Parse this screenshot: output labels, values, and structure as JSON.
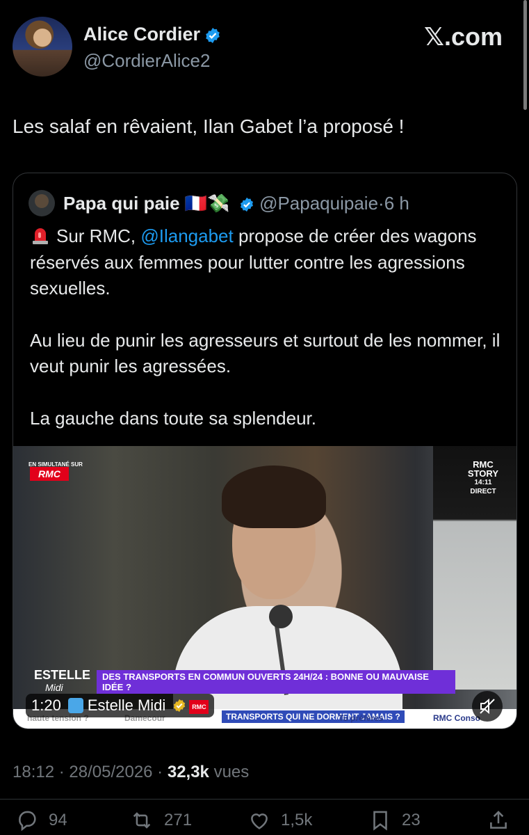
{
  "author": {
    "name": "Alice Cordier",
    "handle": "@CordierAlice2"
  },
  "brand": "𝕏.com",
  "tweet_text": "Les salaf en rêvaient, Ilan Gabet l’a proposé !",
  "quote": {
    "name": "Papa qui paie",
    "flags": "🇫🇷💸",
    "handle": "@Papaquipaie",
    "sep": "·",
    "time": "6 h",
    "line1_pre": "Sur RMC,",
    "mention": "@Ilangabet",
    "line1_post": "propose de créer des wagons réservés aux femmes pour lutter contre les agressions sexuelles.",
    "para2": "Au lieu de punir les agresseurs et surtout de les nommer, il veut punir les agressées.",
    "para3": "La gauche dans toute sa splendeur."
  },
  "video": {
    "simul_label": "EN SIMULTANÉ SUR",
    "rmc": "RMC",
    "story_line1": "RMC",
    "story_line2": "STORY",
    "story_time": "14:11",
    "story_direct": "DIRECT",
    "show_logo_top": "ESTELLE",
    "show_logo_bottom": "Midi",
    "banner": "DES TRANSPORTS EN COMMUN OUVERTS 24H/24 : BONNE OU MAUVAISE IDÉE ?",
    "ticker": [
      "haute tension ?",
      "Damecour",
      "TRANSPORTS QUI NE DORMENT JAMAIS ?",
      "Tu préfères",
      "RMC Conso"
    ],
    "duration": "1:20",
    "channel": "Estelle Midi",
    "channel_badge": "RMC"
  },
  "meta": {
    "time": "18:12",
    "date": "28/05/2026",
    "views": "32,3k",
    "views_label": "vues"
  },
  "actions": {
    "replies": "94",
    "reposts": "271",
    "likes": "1,5k",
    "bookmarks": "23"
  },
  "colors": {
    "accent": "#1d9bf0",
    "muted": "#71767b",
    "banner": "#6f2fd8",
    "rmc_red": "#e2001a"
  }
}
